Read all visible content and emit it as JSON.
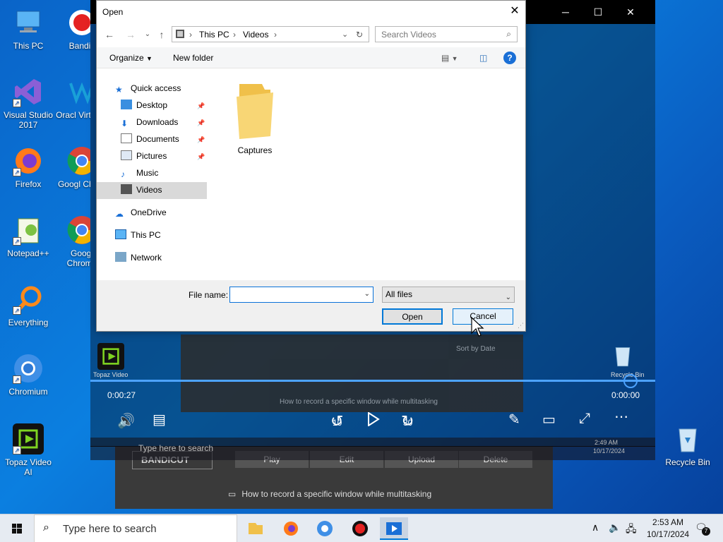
{
  "desktop": {
    "icons": [
      {
        "label": "This PC"
      },
      {
        "label": "Bandic"
      },
      {
        "label": "Visual Studio 2017"
      },
      {
        "label": "Oracl VirtualE"
      },
      {
        "label": "Firefox"
      },
      {
        "label": "Googl Chron"
      },
      {
        "label": "Notepad++"
      },
      {
        "label": "Googl Chrome"
      },
      {
        "label": "Everything"
      },
      {
        "label": "Chromium"
      },
      {
        "label": "Topaz Video AI"
      },
      {
        "label": "Recycle Bin"
      }
    ]
  },
  "player": {
    "time_current": "0:00:27",
    "time_total": "0:00:00",
    "skip_back": "10",
    "skip_forward": "30",
    "inner_search": "Type here to search",
    "inner_time": "2:49 AM",
    "inner_date": "10/17/2024",
    "inner_app_label": "Topaz Video",
    "inner_recycle": "Recycle Bin",
    "inner_sort": "Sort by Date",
    "inner_tip": "How to record a specific window while multitasking"
  },
  "bandicut": {
    "logo": "BANDICUT",
    "buttons": [
      "Play",
      "Edit",
      "Upload",
      "Delete"
    ],
    "tip": "How to record a specific window while multitasking"
  },
  "dialog": {
    "title": "Open",
    "breadcrumb": [
      "This PC",
      "Videos"
    ],
    "search_placeholder": "Search Videos",
    "organize": "Organize",
    "new_folder": "New folder",
    "nav": {
      "quick_access": "Quick access",
      "desktop": "Desktop",
      "downloads": "Downloads",
      "documents": "Documents",
      "pictures": "Pictures",
      "music": "Music",
      "videos": "Videos",
      "onedrive": "OneDrive",
      "thispc": "This PC",
      "network": "Network"
    },
    "folder": "Captures",
    "file_name_label": "File name:",
    "file_name_value": "",
    "file_type": "All files",
    "open_btn": "Open",
    "cancel_btn": "Cancel"
  },
  "taskbar": {
    "search_placeholder": "Type here to search",
    "time": "2:53 AM",
    "date": "10/17/2024",
    "notif_count": "7"
  },
  "colors": {
    "accent": "#0078d7",
    "desktop": "#0b7fe0",
    "taskbar": "#e6ebf2"
  }
}
